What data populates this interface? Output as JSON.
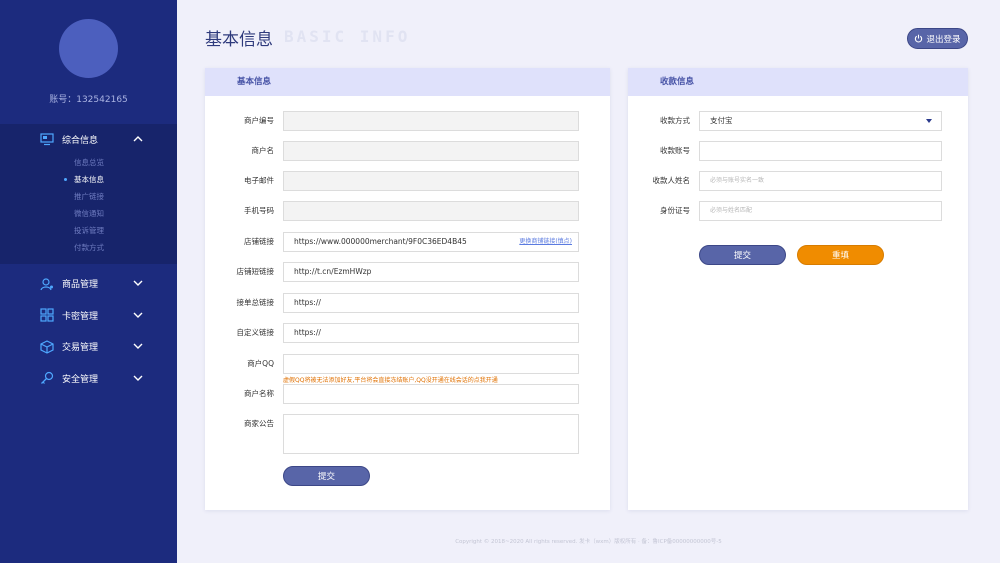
{
  "sidebar": {
    "account_label": "账号：",
    "account_value": "132542165",
    "menu": [
      {
        "label": "综合信息",
        "icon": "monitor-icon",
        "expanded": true,
        "children": [
          {
            "label": "信息总览",
            "active": false
          },
          {
            "label": "基本信息",
            "active": true
          },
          {
            "label": "推广链接",
            "active": false
          },
          {
            "label": "微信通知",
            "active": false
          },
          {
            "label": "投诉管理",
            "active": false
          },
          {
            "label": "付款方式",
            "active": false
          }
        ]
      },
      {
        "label": "商品管理",
        "icon": "user-goods-icon",
        "expanded": false
      },
      {
        "label": "卡密管理",
        "icon": "grid-icon",
        "expanded": false
      },
      {
        "label": "交易管理",
        "icon": "box-icon",
        "expanded": false
      },
      {
        "label": "安全管理",
        "icon": "key-icon",
        "expanded": false
      }
    ]
  },
  "header": {
    "title": "基本信息",
    "title_en": "BASIC INFO",
    "logout_label": "退出登录"
  },
  "basic_panel": {
    "title": "基本信息",
    "fields": [
      {
        "label": "商户编号",
        "value": "",
        "placeholder": ""
      },
      {
        "label": "商户名",
        "value": "",
        "placeholder": ""
      },
      {
        "label": "电子邮件",
        "value": "",
        "placeholder": ""
      },
      {
        "label": "手机号码",
        "value": "",
        "placeholder": ""
      },
      {
        "label": "店铺链接",
        "value": "https://www.000000merchant/9F0C36ED4B45",
        "action": "更换商铺链接(慎点)"
      },
      {
        "label": "店铺短链接",
        "value": "http://t.cn/EzmHWzp"
      },
      {
        "label": "接单总链接",
        "value": "https://"
      },
      {
        "label": "自定义链接",
        "value": "https://"
      },
      {
        "label": "商户QQ",
        "value": "",
        "warning": "虚假QQ将被无法添加好友,平台将会直接冻结账户,QQ没开通在线会话的点我开通"
      },
      {
        "label": "商户名称",
        "value": ""
      },
      {
        "label": "商家公告",
        "value": ""
      }
    ],
    "submit_label": "提交"
  },
  "payment_panel": {
    "title": "收款信息",
    "fields": [
      {
        "label": "收款方式",
        "value": "支付宝"
      },
      {
        "label": "收款账号",
        "value": "",
        "placeholder": ""
      },
      {
        "label": "收款人姓名",
        "value": "",
        "placeholder": "必须与账号实名一致"
      },
      {
        "label": "身份证号",
        "value": "",
        "placeholder": "必须与姓名匹配"
      }
    ],
    "submit_label": "提交",
    "reset_label": "重填"
  },
  "footer": {
    "text": "Copyright © 2018~2020 All rights reserved. 发卡（wxm）版权所有 · 备：鲁ICP备00000000000号-5"
  },
  "colors": {
    "sidebar_bg": "#1c2b7e",
    "panel_head_bg": "#dfe1fb",
    "primary_button": "#5865a8",
    "orange_button": "#f08c00",
    "warning_text": "#e07000"
  }
}
